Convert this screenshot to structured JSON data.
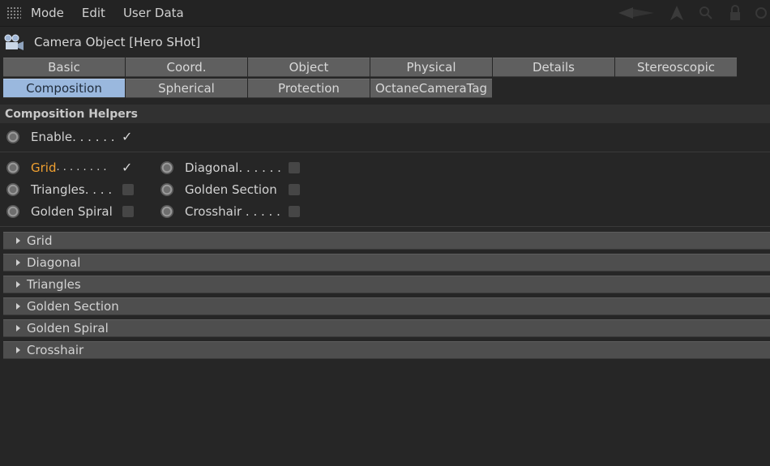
{
  "menubar": {
    "items": [
      "Mode",
      "Edit",
      "User Data"
    ]
  },
  "header": {
    "title": "Camera Object [Hero SHot]"
  },
  "tabs": {
    "row1": [
      "Basic",
      "Coord.",
      "Object",
      "Physical",
      "Details",
      "Stereoscopic"
    ],
    "row2": [
      "Composition",
      "Spherical",
      "Protection",
      "OctaneCameraTag"
    ],
    "active": "Composition"
  },
  "section": {
    "title": "Composition Helpers"
  },
  "params": {
    "enable": {
      "label": "Enable. . . . . .",
      "checked": true
    },
    "grid": {
      "label": "Grid",
      "dots": ". . . . . . . .",
      "checked": true
    },
    "diagonal": {
      "label": "Diagonal. . . . . .",
      "checked": false
    },
    "triangles": {
      "label": "Triangles. . . .",
      "checked": false
    },
    "golden_section": {
      "label": "Golden Section",
      "checked": false
    },
    "golden_spiral": {
      "label": "Golden Spiral",
      "checked": false
    },
    "crosshair": {
      "label": "Crosshair . . . . .",
      "checked": false
    }
  },
  "checkmark_glyph": "✓",
  "groups": [
    "Grid",
    "Diagonal",
    "Triangles",
    "Golden Section",
    "Golden Spiral",
    "Crosshair"
  ],
  "colors": {
    "accent_tab": "#9ab8de",
    "highlight_label": "#f0a030"
  }
}
